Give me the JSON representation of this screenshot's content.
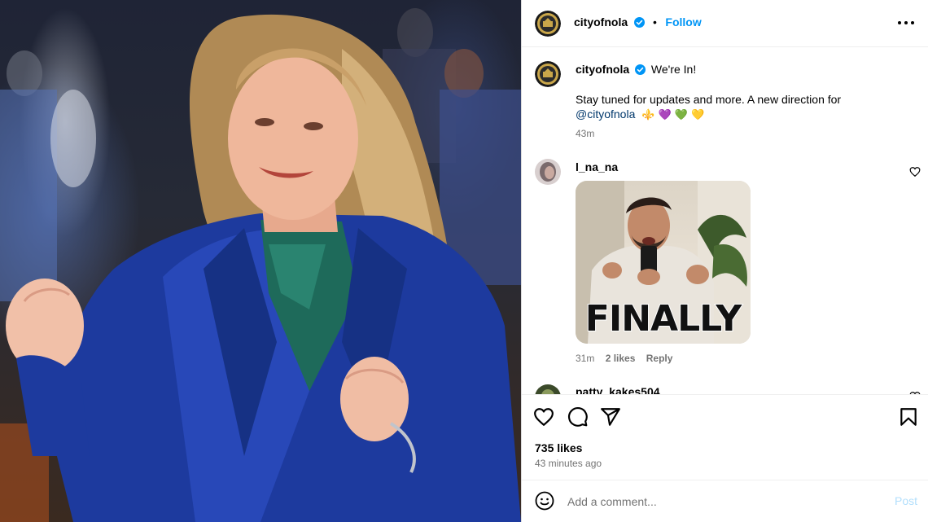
{
  "photo": {
    "alt_icon": "photo-of-smiling-woman-in-blue-suit"
  },
  "header": {
    "username": "cityofnola",
    "separator": "•",
    "follow_label": "Follow"
  },
  "caption": {
    "username": "cityofnola",
    "headline": "We're In!",
    "body": "Stay tuned for updates and more. A new direction for",
    "mention": "@cityofnola",
    "emojis": "⚜️ 💜 💚 💛",
    "time": "43m"
  },
  "comments": [
    {
      "username": "l_na_na",
      "gif_text": "FINALLY",
      "time": "31m",
      "likes": "2 likes",
      "reply_label": "Reply"
    },
    {
      "username": "patty_kakes504"
    }
  ],
  "actions": {
    "likes": "735 likes",
    "posted": "43 minutes ago"
  },
  "composer": {
    "placeholder": "Add a comment...",
    "post_label": "Post"
  },
  "colors": {
    "accent": "#0095f6",
    "verified": "#0095f6",
    "muted": "#737373",
    "post_disabled": "#b2dffc"
  }
}
